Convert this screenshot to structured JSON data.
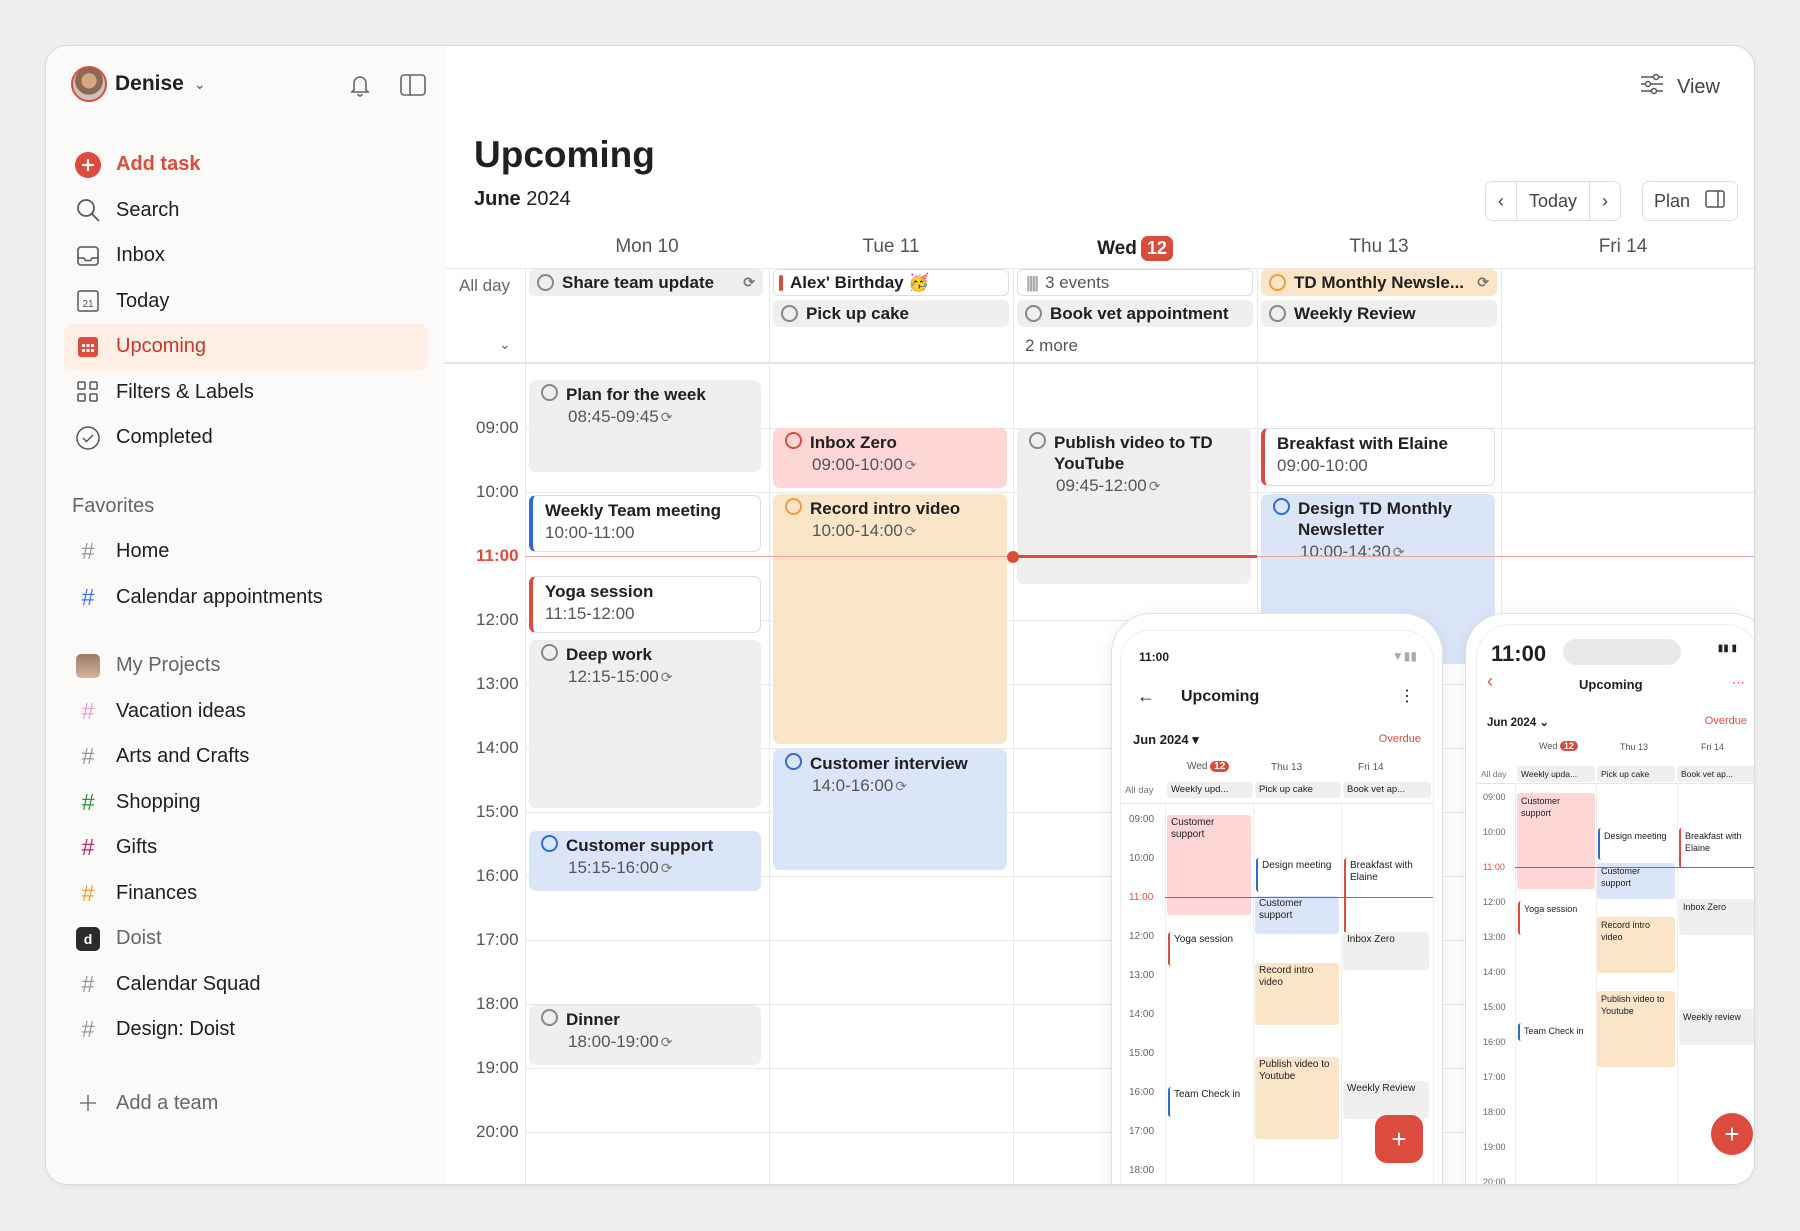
{
  "sidebar": {
    "user": "Denise",
    "add_task": "Add task",
    "nav": [
      "Search",
      "Inbox",
      "Today",
      "Upcoming",
      "Filters & Labels",
      "Completed"
    ],
    "favorites_header": "Favorites",
    "favorites": [
      {
        "name": "Home",
        "color": "#999999"
      },
      {
        "name": "Calendar appointments",
        "color": "#4073ff"
      }
    ],
    "my_projects_header": "My Projects",
    "projects": [
      {
        "name": "Vacation ideas",
        "color": "#e89fd6"
      },
      {
        "name": "Arts and Crafts",
        "color": "#999999"
      },
      {
        "name": "Shopping",
        "color": "#299438"
      },
      {
        "name": "Gifts",
        "color": "#b8256f"
      },
      {
        "name": "Finances",
        "color": "#f09c3a"
      }
    ],
    "team_header": "Doist",
    "team_projects": [
      "Calendar Squad",
      "Design: Doist"
    ],
    "add_team": "Add a team"
  },
  "header": {
    "view_label": "View",
    "title": "Upcoming",
    "month_bold": "June",
    "year": "2024",
    "today_btn": "Today",
    "plan_btn": "Plan"
  },
  "days": [
    {
      "label": "Mon 10"
    },
    {
      "label": "Tue 11"
    },
    {
      "label": "Wed",
      "badge": "12"
    },
    {
      "label": "Thu 13"
    },
    {
      "label": "Fri 14"
    }
  ],
  "allday": {
    "label": "All day",
    "items": [
      "Share team update",
      "Alex' Birthday 🥳",
      "Pick up cake",
      "3 events",
      "Book vet appointment",
      "2 more",
      "TD Monthly Newsle...",
      "Weekly Review"
    ]
  },
  "hours": [
    "09:00",
    "10:00",
    "11:00",
    "12:00",
    "13:00",
    "14:00",
    "15:00",
    "16:00",
    "17:00",
    "18:00",
    "19:00",
    "20:00"
  ],
  "events": [
    {
      "title": "Plan for the week",
      "time": "08:45-09:45"
    },
    {
      "title": "Weekly Team meeting",
      "time": "10:00-11:00"
    },
    {
      "title": "Yoga session",
      "time": "11:15-12:00"
    },
    {
      "title": "Deep work",
      "time": "12:15-15:00"
    },
    {
      "title": "Customer support",
      "time": "15:15-16:00"
    },
    {
      "title": "Dinner",
      "time": "18:00-19:00"
    },
    {
      "title": "Inbox Zero",
      "time": "09:00-10:00"
    },
    {
      "title": "Record intro video",
      "time": "10:00-14:00"
    },
    {
      "title": "Customer interview",
      "time": "14:0-16:00"
    },
    {
      "title": "Publish video to TD YouTube",
      "time": "09:45-12:00"
    },
    {
      "title": "Breakfast with Elaine",
      "time": "09:00-10:00"
    },
    {
      "title": "Design TD Monthly Newsletter",
      "time": "10:00-14:30"
    }
  ],
  "phone1": {
    "clock": "11:00",
    "title": "Upcoming",
    "month": "Jun 2024",
    "overdue": "Overdue",
    "days": [
      "Wed",
      "12",
      "Thu 13",
      "Fri 14"
    ],
    "allday_label": "All day",
    "allday": [
      "Weekly upd...",
      "Pick up cake",
      "Book vet ap..."
    ],
    "hours": [
      "09:00",
      "10:00",
      "11:00",
      "12:00",
      "13:00",
      "14:00",
      "15:00",
      "16:00",
      "17:00",
      "18:00"
    ],
    "events": [
      "Customer support",
      "Design meeting",
      "Customer support",
      "Breakfast with Elaine",
      "Yoga session",
      "Inbox Zero",
      "Record intro video",
      "Publish video to Youtube",
      "Team Check in",
      "Weekly Review"
    ]
  },
  "phone2": {
    "clock": "11:00",
    "title": "Upcoming",
    "month": "Jun 2024",
    "overdue": "Overdue",
    "days": [
      "Wed",
      "12",
      "Thu 13",
      "Fri 14"
    ],
    "allday_label": "All day",
    "allday": [
      "Weekly upda...",
      "Pick up cake",
      "Book vet ap..."
    ],
    "hours": [
      "09:00",
      "10:00",
      "11:00",
      "12:00",
      "13:00",
      "14:00",
      "15:00",
      "16:00",
      "17:00",
      "18:00",
      "19:00",
      "20:00"
    ],
    "events": [
      "Customer support",
      "Design meeting",
      "Breakfast with Elaine",
      "Customer support",
      "Yoga session",
      "Inbox Zero",
      "Record intro video",
      "Publish video to Youtube",
      "Weekly review",
      "Team Check in"
    ]
  },
  "colors": {
    "accent": "#dc4c3e",
    "active_bg": "#ffefe5",
    "gray_event": "#f1efee",
    "pink_event": "#ffd6d6",
    "peach_event": "#fbe5c8",
    "blue_event": "#dbe5f8"
  }
}
